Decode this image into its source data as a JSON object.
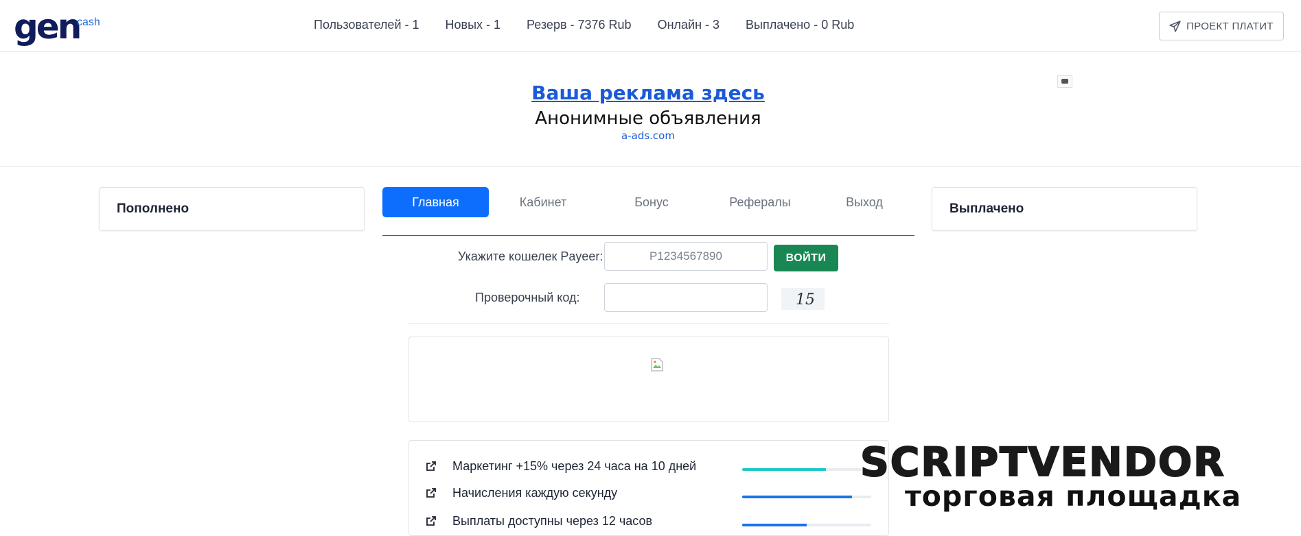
{
  "header": {
    "logo_main": "gen",
    "logo_sup": "cash",
    "stats": [
      "Пользователей - 1",
      "Новых - 1",
      "Резерв - 7376 Rub",
      "Онлайн - 3",
      "Выплачено - 0 Rub"
    ],
    "project_button": "ПРОЕКТ ПЛАТИТ"
  },
  "ad": {
    "title": "Ваша реклама здесь",
    "subtitle": "Анонимные объявления",
    "link": "a-ads.com"
  },
  "left_card": {
    "title": "Пополнено"
  },
  "right_card": {
    "title": "Выплачено"
  },
  "tabs": [
    "Главная",
    "Кабинет",
    "Бонус",
    "Рефералы",
    "Выход"
  ],
  "form": {
    "wallet_label": "Укажите кошелек Payeer:",
    "wallet_placeholder": "P1234567890",
    "wallet_value": "",
    "login_button": "ВОЙТИ",
    "captcha_label": "Проверочный код:",
    "captcha_value": "",
    "captcha_text": "15"
  },
  "features": [
    {
      "text": "Маркетинг +15% через 24 часа на 10 дней",
      "progress": 0.65,
      "color": "#20c9c9"
    },
    {
      "text": "Начисления каждую секунду",
      "progress": 0.85,
      "color": "#1a73e8"
    },
    {
      "text": "Выплаты доступны через 12 часов",
      "progress": 0.5,
      "color": "#1a73e8"
    }
  ],
  "watermark": {
    "top": "SCRIPTVENDOR",
    "bottom": "торговая площадка"
  },
  "icons": {
    "send": "send-icon",
    "external_link": "external-link-icon",
    "broken_image": "broken-image-icon"
  }
}
